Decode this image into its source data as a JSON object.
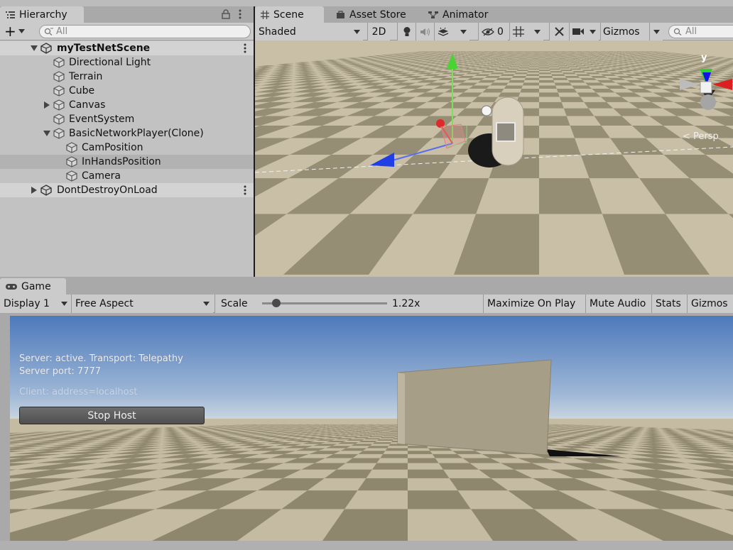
{
  "hierarchy": {
    "tab_label": "Hierarchy",
    "add_label": "+",
    "search_placeholder": "All",
    "rows": [
      {
        "label": "myTestNetScene"
      },
      {
        "label": "Directional Light"
      },
      {
        "label": "Terrain"
      },
      {
        "label": "Cube"
      },
      {
        "label": "Canvas"
      },
      {
        "label": "EventSystem"
      },
      {
        "label": "BasicNetworkPlayer(Clone)"
      },
      {
        "label": "CamPosition"
      },
      {
        "label": "InHandsPosition"
      },
      {
        "label": "Camera"
      },
      {
        "label": "DontDestroyOnLoad"
      }
    ]
  },
  "scene": {
    "tabs": [
      {
        "label": "Scene"
      },
      {
        "label": "Asset Store"
      },
      {
        "label": "Animator"
      }
    ],
    "toolbar": {
      "shading_mode": "Shaded",
      "mode_2d": "2D",
      "hidden_count": "0",
      "gizmos": "Gizmos",
      "search_placeholder": "All"
    },
    "view": {
      "axis_label": "y",
      "projection_label": "< Persp",
      "sky_color": "#c9c3b6",
      "ground_light": "#c8bfa6",
      "ground_dark": "#8a8269"
    }
  },
  "game": {
    "tab_label": "Game",
    "toolbar": {
      "display": "Display 1",
      "aspect": "Free Aspect",
      "scale_label": "Scale",
      "scale_value": "1.22x",
      "scale_slider_level": 0.08,
      "maximize": "Maximize On Play",
      "mute": "Mute Audio",
      "stats": "Stats",
      "gizmos": "Gizmos"
    },
    "overlay": {
      "server_status": "Server: active. Transport: Telepathy",
      "server_port": "Server port: 7777",
      "client_address": "Client: address=localhost",
      "stop_host": "Stop Host"
    },
    "colors": {
      "sky_top": "#4f7bbd",
      "sky_horizon": "#b4c8dc",
      "wall": "#a79e87"
    }
  }
}
